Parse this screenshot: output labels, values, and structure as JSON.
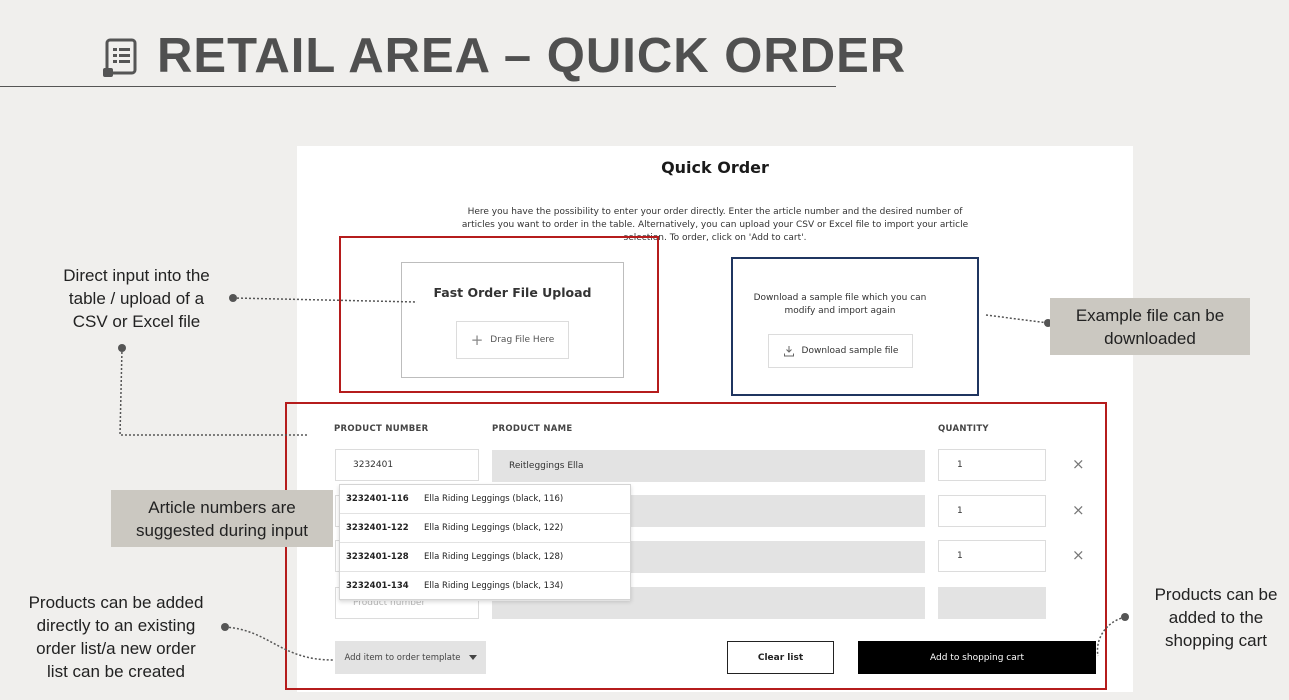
{
  "slide": {
    "title": "RETAIL AREA – QUICK ORDER"
  },
  "quick_order": {
    "title": "Quick Order",
    "intro": "Here you have the possibility to enter your order directly. Enter the article number and the desired number of articles you want to order in the table. Alternatively, you can upload your CSV or Excel file to import your article selection. To order, click on 'Add to cart'.",
    "upload_title": "Fast Order File Upload",
    "drag_label": "Drag File Here",
    "sample_text": "Download a sample file which you can modify and import again",
    "sample_button": "Download sample file",
    "columns": {
      "product_number": "PRODUCT NUMBER",
      "product_name": "PRODUCT NAME",
      "quantity": "QUANTITY"
    },
    "rows": [
      {
        "number": "3232401",
        "name": "Reitleggings Ella",
        "quantity": "1"
      },
      {
        "number": "",
        "name": "",
        "quantity": "1"
      },
      {
        "number": "",
        "name": "",
        "quantity": "1"
      },
      {
        "number": "",
        "name": "",
        "quantity": ""
      }
    ],
    "product_number_placeholder": "Product number",
    "suggestions": [
      {
        "number": "3232401-116",
        "name": "Ella Riding Leggings (black, 116)"
      },
      {
        "number": "3232401-122",
        "name": "Ella Riding Leggings (black, 122)"
      },
      {
        "number": "3232401-128",
        "name": "Ella Riding Leggings (black, 128)"
      },
      {
        "number": "3232401-134",
        "name": "Ella Riding Leggings (black, 134)"
      }
    ],
    "template_button": "Add item to order template",
    "clear_button": "Clear list",
    "cart_button": "Add to shopping cart",
    "remove_glyph": "×"
  },
  "callouts": {
    "direct_input": [
      "Direct input into the",
      "table / upload of a",
      "CSV or Excel file"
    ],
    "example_file": [
      "Example file can be",
      "downloaded"
    ],
    "suggested": [
      "Article numbers are",
      "suggested during input"
    ],
    "order_list": [
      "Products can be added",
      "directly to an existing",
      "order list/a new order",
      "list can be created"
    ],
    "cart": [
      "Products can be",
      "added to the",
      "shopping cart"
    ]
  },
  "colors": {
    "highlight_red": "#b51c1c",
    "highlight_blue": "#1f3560",
    "callout_box": "#cbc8c1"
  },
  "icons": [
    "document-icon",
    "plus-icon",
    "download-icon",
    "close-icon",
    "dropdown-arrow-icon"
  ]
}
